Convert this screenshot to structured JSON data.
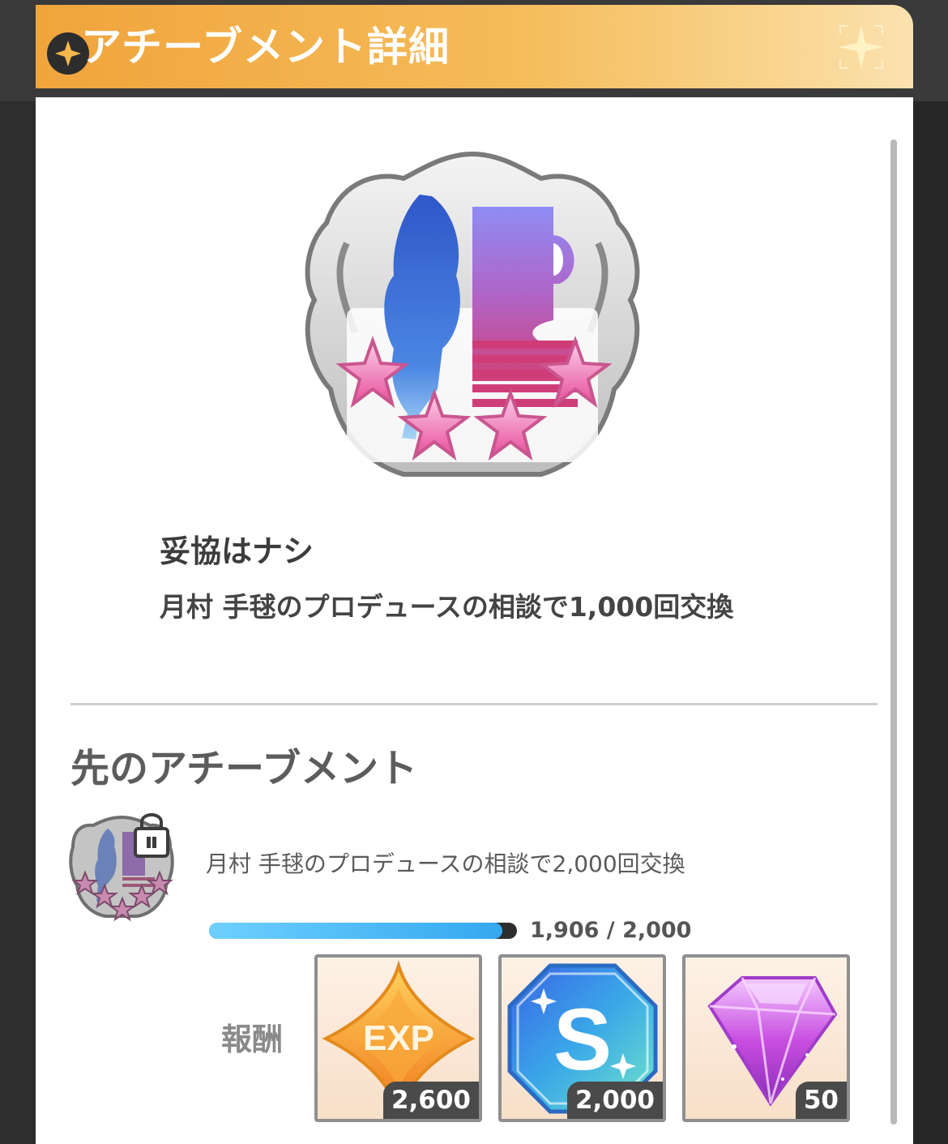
{
  "header": {
    "title": "アチーブメント詳細"
  },
  "achievement": {
    "title": "妥協はナシ",
    "description": "月村 手毬のプロデュースの相談で1,000回交換"
  },
  "next_section": {
    "heading": "先のアチーブメント",
    "item": {
      "description": "月村 手毬のプロデュースの相談で2,000回交換",
      "progress_current": 1906,
      "progress_max": 2000,
      "progress_text": "1,906 / 2,000",
      "locked": true
    },
    "rewards_label": "報酬",
    "rewards": [
      {
        "icon": "exp-icon",
        "badge_text": "EXP",
        "count": "2,600"
      },
      {
        "icon": "s-ticket-icon",
        "badge_text": "S",
        "count": "2,000"
      },
      {
        "icon": "gem-icon",
        "count": "50"
      }
    ]
  },
  "colors": {
    "header_gradient_start": "#f0a43c",
    "header_gradient_end": "#fbe2b0",
    "progress_fill": "#34a8ef",
    "star_pink": "#f07ab8"
  }
}
